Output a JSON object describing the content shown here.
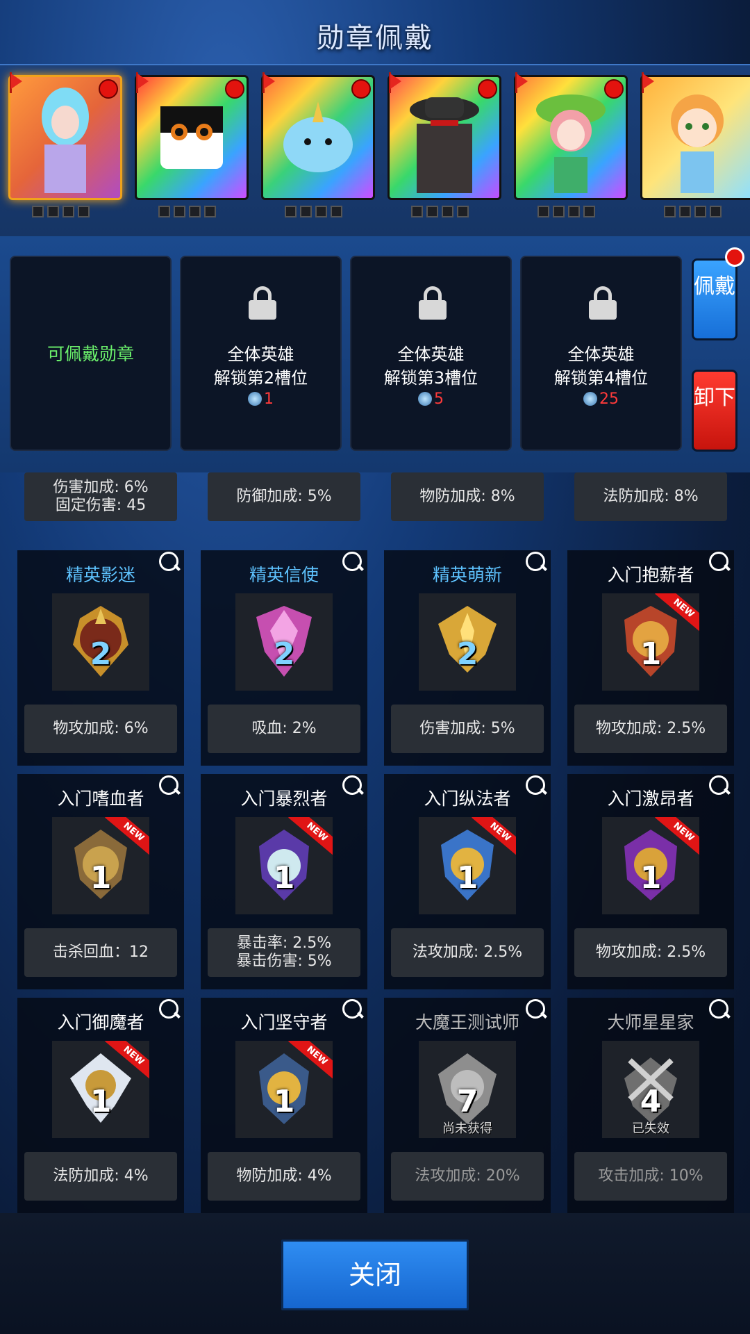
{
  "page": {
    "title": "勋章佩戴"
  },
  "heroes": [
    {
      "name": "hero-1",
      "selected": true
    },
    {
      "name": "hero-2",
      "selected": false
    },
    {
      "name": "hero-3",
      "selected": false
    },
    {
      "name": "hero-4",
      "selected": false
    },
    {
      "name": "hero-5",
      "selected": false
    },
    {
      "name": "hero-6",
      "selected": false
    }
  ],
  "slots": {
    "slot1": {
      "label": "可佩戴勋章"
    },
    "slot2": {
      "line1": "全体英雄",
      "line2": "解锁第2槽位",
      "cost": "1"
    },
    "slot3": {
      "line1": "全体英雄",
      "line2": "解锁第3槽位",
      "cost": "5"
    },
    "slot4": {
      "line1": "全体英雄",
      "line2": "解锁第4槽位",
      "cost": "25"
    }
  },
  "side_buttons": {
    "wear": "佩戴",
    "remove": "卸下"
  },
  "partial_row": [
    {
      "line1": "伤害加成: 6%",
      "line2": "固定伤害: 45"
    },
    {
      "line1": "防御加成: 5%"
    },
    {
      "line1": "物防加成: 8%"
    },
    {
      "line1": "法防加成: 8%"
    }
  ],
  "medals": [
    {
      "name": "精英影迷",
      "level": "2",
      "stat1": "物攻加成: 6%"
    },
    {
      "name": "精英信使",
      "level": "2",
      "stat1": "吸血: 2%"
    },
    {
      "name": "精英萌新",
      "level": "2",
      "stat1": "伤害加成: 5%"
    },
    {
      "name": "入门抱薪者",
      "level": "1",
      "new": "NEW",
      "stat1": "物攻加成: 2.5%"
    },
    {
      "name": "入门嗜血者",
      "level": "1",
      "new": "NEW",
      "stat1": "击杀回血：12"
    },
    {
      "name": "入门暴烈者",
      "level": "1",
      "new": "NEW",
      "stat1": "暴击率: 2.5%",
      "stat2": "暴击伤害:  5%"
    },
    {
      "name": "入门纵法者",
      "level": "1",
      "new": "NEW",
      "stat1": "法攻加成: 2.5%"
    },
    {
      "name": "入门激昂者",
      "level": "1",
      "new": "NEW",
      "stat1": "物攻加成: 2.5%"
    },
    {
      "name": "入门御魔者",
      "level": "1",
      "new": "NEW",
      "stat1": "法防加成: 4%"
    },
    {
      "name": "入门坚守者",
      "level": "1",
      "new": "NEW",
      "stat1": "物防加成: 4%"
    },
    {
      "name": "大魔王测试师",
      "level": "7",
      "status": "尚未获得",
      "stat1": "法攻加成: 20%"
    },
    {
      "name": "大师星星家",
      "level": "4",
      "status": "已失效",
      "stat1": "攻击加成: 10%"
    }
  ],
  "close_button": "关闭",
  "colors": {
    "accent": "#176fd8",
    "elite_name": "#5ec3ff",
    "available": "#6cf26c",
    "cost": "#ff3a3a",
    "danger": "#c7140d",
    "selected_border": "#f0a21b"
  },
  "icons": [
    "lock-icon",
    "gem-icon",
    "magnifier-icon",
    "flag-icon",
    "notification-dot-icon"
  ]
}
